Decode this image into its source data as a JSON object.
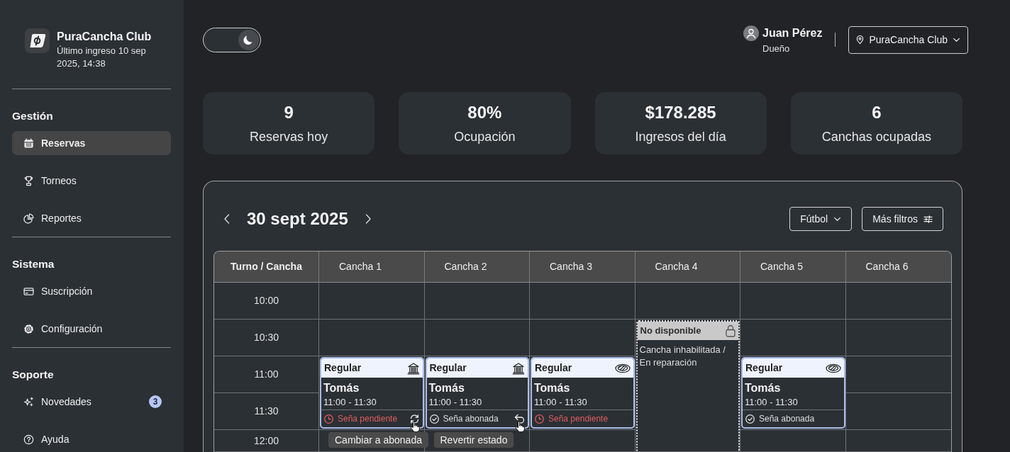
{
  "sidebar": {
    "brand": {
      "title": "PuraCancha Club",
      "subtitle": "Último ingreso 10 sep 2025, 14:38"
    },
    "sections": [
      {
        "title": "Gestión",
        "items": [
          {
            "label": "Reservas",
            "selected": true
          },
          {
            "label": "Torneos",
            "selected": false
          },
          {
            "label": "Reportes",
            "selected": false
          }
        ]
      },
      {
        "title": "Sistema",
        "items": [
          {
            "label": "Suscripción",
            "selected": false
          },
          {
            "label": "Configuración",
            "selected": false
          }
        ]
      },
      {
        "title": "Soporte",
        "items": [
          {
            "label": "Novedades",
            "selected": false,
            "badge": "3"
          },
          {
            "label": "Ayuda",
            "selected": false
          }
        ]
      }
    ]
  },
  "header": {
    "theme_toggle": {
      "on": true
    },
    "user": {
      "name": "Juan Pérez",
      "role": "Dueño"
    },
    "club_select": {
      "value": "PuraCancha Club"
    }
  },
  "stats": [
    {
      "value": "9",
      "label": "Reservas hoy"
    },
    {
      "value": "80%",
      "label": "Ocupación"
    },
    {
      "value": "$178.285",
      "label": "Ingresos del día"
    },
    {
      "value": "6",
      "label": "Canchas ocupadas"
    }
  ],
  "calendar": {
    "date": "30 sept 2025",
    "filters": [
      {
        "label": "Fútbol",
        "kind": "dropdown"
      },
      {
        "label": "Más filtros",
        "kind": "panel"
      }
    ],
    "corner": "Turno / Cancha",
    "columns": [
      "Cancha 1",
      "Cancha 2",
      "Cancha 3",
      "Cancha 4",
      "Cancha 5",
      "Cancha 6"
    ],
    "rows": [
      {
        "time": "10:00",
        "cells": [
          {
            "kind": "empty"
          },
          {
            "kind": "empty"
          },
          {
            "kind": "empty"
          },
          {
            "kind": "empty"
          },
          {
            "kind": "empty"
          },
          {
            "kind": "empty"
          }
        ]
      },
      {
        "time": "10:30",
        "cells": [
          {
            "kind": "empty"
          },
          {
            "kind": "empty"
          },
          {
            "kind": "empty"
          },
          {
            "kind": "unavailable",
            "title": "No disponible",
            "note": "Cancha inhabilitada / En reparación"
          },
          {
            "kind": "empty"
          },
          {
            "kind": "empty"
          }
        ]
      },
      {
        "time": "11:00",
        "cells": [
          {
            "kind": "booking",
            "type": "Regular",
            "payment": {
              "kind": "transfer"
            },
            "name": "Tomás",
            "time": "11:00 - 11:30",
            "status": "Seña pendiente",
            "paid": false,
            "hovered": true,
            "tooltip": "Cambiar a abonada"
          },
          {
            "kind": "booking",
            "type": "Regular",
            "payment": {
              "kind": "transfer"
            },
            "name": "Tomás",
            "time": "11:00 - 11:30",
            "status": "Seña abonada",
            "paid": true,
            "hovered": true,
            "tooltip": "Revertir estado"
          },
          {
            "kind": "booking",
            "type": "Regular",
            "payment": {
              "kind": "cash"
            },
            "name": "Tomás",
            "time": "11:00 - 11:30",
            "status": "Seña pendiente",
            "paid": false,
            "hovered": false
          },
          {
            "kind": "covered"
          },
          {
            "kind": "booking",
            "type": "Regular",
            "payment": {
              "kind": "cash"
            },
            "name": "Tomás",
            "time": "11:00 - 11:30",
            "status": "Seña abonada",
            "paid": true,
            "hovered": false
          },
          {
            "kind": "empty"
          }
        ]
      },
      {
        "time": "11:30",
        "cells": [
          {
            "kind": "covered"
          },
          {
            "kind": "covered"
          },
          {
            "kind": "covered"
          },
          {
            "kind": "covered"
          },
          {
            "kind": "covered"
          },
          {
            "kind": "empty"
          }
        ]
      },
      {
        "time": "12:00",
        "cells": [
          {
            "kind": "empty"
          },
          {
            "kind": "empty"
          },
          {
            "kind": "empty"
          },
          {
            "kind": "covered"
          },
          {
            "kind": "empty"
          },
          {
            "kind": "empty"
          }
        ]
      }
    ]
  }
}
